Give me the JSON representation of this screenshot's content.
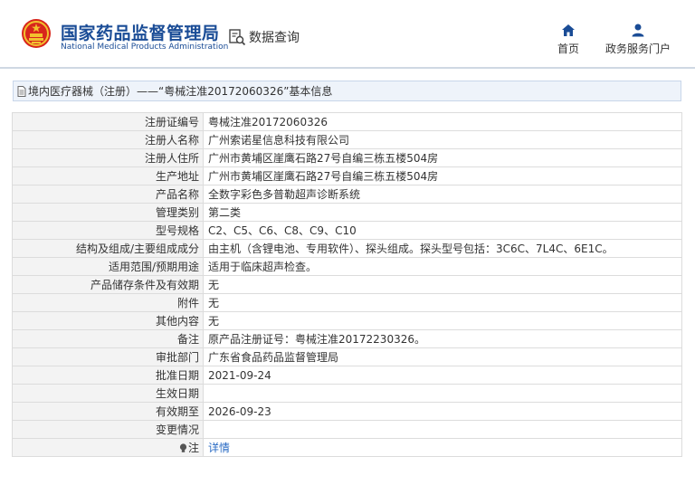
{
  "header": {
    "logo_cn": "国家药品监督管理局",
    "logo_en": "National Medical Products Administration",
    "query_label": "数据查询",
    "nav": [
      {
        "label": "首页",
        "icon": "home-icon"
      },
      {
        "label": "政务服务门户",
        "icon": "user-icon"
      }
    ]
  },
  "breadcrumb": {
    "category": "境内医疗器械（注册）",
    "separator": "——",
    "record": "“粤械注准20172060326”基本信息"
  },
  "colors": {
    "brand": "#1a4c96",
    "link": "#2a6bc4",
    "label_bg": "#f3f3f3",
    "crumb_bg": "#eef3fa"
  },
  "details": [
    {
      "label": "注册证编号",
      "value": "粤械注准20172060326"
    },
    {
      "label": "注册人名称",
      "value": "广州索诺星信息科技有限公司"
    },
    {
      "label": "注册人住所",
      "value": "广州市黄埔区崖鹰石路27号自编三栋五楼504房"
    },
    {
      "label": "生产地址",
      "value": "广州市黄埔区崖鹰石路27号自编三栋五楼504房"
    },
    {
      "label": "产品名称",
      "value": "全数字彩色多普勒超声诊断系统"
    },
    {
      "label": "管理类别",
      "value": "第二类"
    },
    {
      "label": "型号规格",
      "value": "C2、C5、C6、C8、C9、C10"
    },
    {
      "label": "结构及组成/主要组成成分",
      "value": "由主机（含锂电池、专用软件）、探头组成。探头型号包括：3C6C、7L4C、6E1C。"
    },
    {
      "label": "适用范围/预期用途",
      "value": "适用于临床超声检查。"
    },
    {
      "label": "产品储存条件及有效期",
      "value": "无"
    },
    {
      "label": "附件",
      "value": "无"
    },
    {
      "label": "其他内容",
      "value": "无"
    },
    {
      "label": "备注",
      "value": "原产品注册证号：粤械注准20172230326。"
    },
    {
      "label": "审批部门",
      "value": "广东省食品药品监督管理局"
    },
    {
      "label": "批准日期",
      "value": "2021-09-24"
    },
    {
      "label": "生效日期",
      "value": ""
    },
    {
      "label": "有效期至",
      "value": "2026-09-23"
    },
    {
      "label": "变更情况",
      "value": ""
    },
    {
      "label": "注",
      "value": "详情"
    }
  ]
}
